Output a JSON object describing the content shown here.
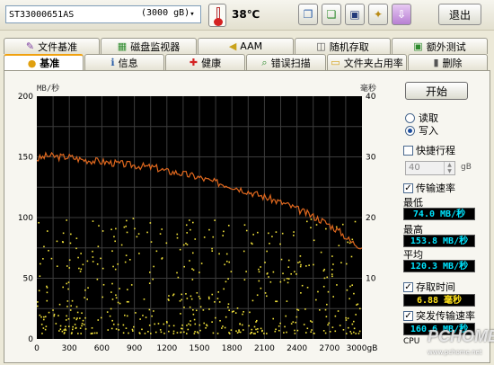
{
  "toolbar": {
    "drive_name": "ST33000651AS",
    "drive_capacity": "(3000 gB)",
    "dropdown_arrow": "▾",
    "temperature": "38℃",
    "exit_label": "退出",
    "icons": [
      "copy-icon",
      "copy-all-icon",
      "save-icon",
      "options-icon",
      "down-arrow-icon"
    ]
  },
  "tabs_top": [
    {
      "label": "文件基准",
      "icon": "file-benchmark-icon",
      "glyph": "✎"
    },
    {
      "label": "磁盘监视器",
      "icon": "disk-monitor-icon",
      "glyph": "▦"
    },
    {
      "label": "AAM",
      "icon": "speaker-icon",
      "glyph": "◀"
    },
    {
      "label": "随机存取",
      "icon": "random-access-icon",
      "glyph": "◫"
    },
    {
      "label": "额外测试",
      "icon": "extra-tests-icon",
      "glyph": "▣"
    }
  ],
  "tabs_bottom": [
    {
      "label": "基准",
      "icon": "benchmark-icon",
      "glyph": "●",
      "active": true
    },
    {
      "label": "信息",
      "icon": "info-icon",
      "glyph": "ℹ"
    },
    {
      "label": "健康",
      "icon": "health-icon",
      "glyph": "✚"
    },
    {
      "label": "错误扫描",
      "icon": "error-scan-icon",
      "glyph": "⌕"
    },
    {
      "label": "文件夹占用率",
      "icon": "folder-usage-icon",
      "glyph": "▭"
    },
    {
      "label": "删除",
      "icon": "delete-icon",
      "glyph": "▮"
    }
  ],
  "side": {
    "start_label": "开始",
    "read_label": "读取",
    "write_label": "写入",
    "short_stroke_label": "快捷行程",
    "short_stroke_value": "40",
    "short_stroke_unit": "gB",
    "transfer_rate_label": "传输速率",
    "min_label": "最低",
    "min_value": "74.0 MB/秒",
    "max_label": "最高",
    "max_value": "153.8 MB/秒",
    "avg_label": "平均",
    "avg_value": "120.3 MB/秒",
    "access_time_label": "存取时间",
    "access_time_value": "6.88 毫秒",
    "burst_label": "突发传输速率",
    "burst_value": "160.6 MB/秒",
    "cpu_label": "CPU"
  },
  "watermark": {
    "logo": "PCHOME",
    "url": "www.pchome.net"
  },
  "chart_data": {
    "type": "line",
    "ylabel": "MB/秒",
    "y2label": "毫秒",
    "xlabel_unit": "gB",
    "ylim": [
      0,
      200
    ],
    "y2lim": [
      0,
      40
    ],
    "xlim": [
      0,
      3000
    ],
    "grid": true,
    "x_ticks": [
      "0",
      "300",
      "600",
      "900",
      "1200",
      "1500",
      "1800",
      "2100",
      "2400",
      "2700",
      "3000gB"
    ],
    "y_ticks": [
      "0",
      "50",
      "100",
      "150",
      "200"
    ],
    "y2_ticks": [
      "10",
      "20",
      "30",
      "40"
    ],
    "series": [
      {
        "name": "传输速率",
        "color": "#e0681e",
        "x": [
          0,
          100,
          200,
          300,
          400,
          500,
          600,
          700,
          800,
          900,
          1000,
          1100,
          1200,
          1300,
          1400,
          1500,
          1600,
          1700,
          1800,
          1900,
          2000,
          2100,
          2200,
          2300,
          2400,
          2500,
          2600,
          2700,
          2800,
          2900,
          3000
        ],
        "y": [
          148,
          151,
          150,
          150,
          148,
          147,
          146,
          145,
          144,
          143,
          142,
          141,
          138,
          137,
          135,
          133,
          130,
          128,
          126,
          123,
          120,
          117,
          114,
          111,
          107,
          103,
          99,
          94,
          88,
          80,
          76
        ]
      },
      {
        "name": "存取时间",
        "color": "#f2e23a",
        "style": "scatter",
        "axis": "y2",
        "y_range": [
          1,
          20
        ],
        "avg": 6.88
      }
    ]
  }
}
